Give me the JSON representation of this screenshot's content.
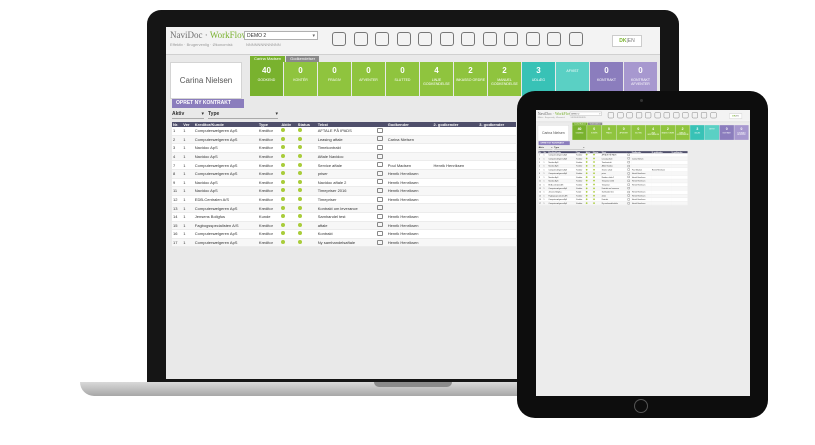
{
  "app": {
    "logo_navi": "NaviDoc",
    "logo_wf": "WorkFlow",
    "tagline": "Effektiv · Brugervenlig · Økonomisk",
    "company_select": "DEMO 2",
    "company_sub": "NNNNNNNNNNNN",
    "lang_da": "DK",
    "lang_en": "EN"
  },
  "icons": [
    "search-icon",
    "document-search-icon",
    "list-search-icon",
    "chart-icon",
    "bank-icon",
    "binders-icon",
    "refresh-icon",
    "bus-icon",
    "key-icon",
    "gear-icon",
    "chat-icon",
    "exit-icon"
  ],
  "user": {
    "name": "Carina Nielsen"
  },
  "tabs": [
    "Carina Madsen",
    "Godkendelser"
  ],
  "tiles": [
    {
      "n": "40",
      "label": "GODKEND",
      "color": "#79b22e"
    },
    {
      "n": "0",
      "label": "KONTÉR",
      "color": "#8fc43e"
    },
    {
      "n": "0",
      "label": "FRAGIV",
      "color": "#8fc43e"
    },
    {
      "n": "0",
      "label": "AFVENTER",
      "color": "#8fc43e"
    },
    {
      "n": "0",
      "label": "SLUTTED",
      "color": "#8fc43e"
    },
    {
      "n": "4",
      "label": "LINJE GODKENDELSE",
      "color": "#8fc43e"
    },
    {
      "n": "2",
      "label": "INKASSO ORDRE",
      "color": "#8fc43e"
    },
    {
      "n": "2",
      "label": "MANUEL GODKENDELSE",
      "color": "#8fc43e"
    },
    {
      "n": "3",
      "label": "UDLÆG",
      "color": "#38c2b6"
    },
    {
      "n": "",
      "label": "AFVIST",
      "color": "#5ad0c4"
    },
    {
      "n": "0",
      "label": "KONTRAKT",
      "color": "#8b7dbd"
    },
    {
      "n": "0",
      "label": "KONTRAKT AFVENTER",
      "color": "#a798cf"
    }
  ],
  "new_contract": "OPRET NY KONTRAKT",
  "filters": {
    "status": "Aktiv",
    "type": "Type"
  },
  "table": {
    "headers": [
      "Nr.",
      "Ver",
      "Kreditor/Kunde",
      "Type",
      "Aktiv",
      "Status",
      "Tekst",
      "",
      "Godkender",
      "2. godkender",
      "3. godkender"
    ],
    "rows": [
      [
        "1",
        "1",
        "Computersælgeren ApS",
        "Kreditor",
        "AFTALE PÅ IPADS",
        "",
        ""
      ],
      [
        "2",
        "1",
        "Computersælgeren ApS",
        "Kreditor",
        "Leasing aftale",
        "Carina Nielsen",
        ""
      ],
      [
        "3",
        "1",
        "Navidoc ApS",
        "Kreditor",
        "Timekontrakt",
        "",
        ""
      ],
      [
        "4",
        "1",
        "Navidoc ApS",
        "Kreditor",
        "Aftale Navidoc",
        "",
        ""
      ],
      [
        "7",
        "1",
        "Computersælgeren ApS",
        "Kreditor",
        "Service aftale",
        "Poul Madsen",
        "Henrik Henriksen"
      ],
      [
        "8",
        "1",
        "Computersælgeren ApS",
        "Kreditor",
        "priser",
        "Henrik Henriksen",
        ""
      ],
      [
        "9",
        "1",
        "Navidoc ApS",
        "Kreditor",
        "Navidoc aftale 2",
        "Henrik Henriksen",
        ""
      ],
      [
        "11",
        "1",
        "Navidoc ApS",
        "Kreditor",
        "Timepriser 2016",
        "Henrik Henriksen",
        ""
      ],
      [
        "12",
        "1",
        "EDB-Centralen A/S",
        "Kreditor",
        "Timepriser",
        "Henrik Henriksen",
        ""
      ],
      [
        "13",
        "1",
        "Computersælgeren ApS",
        "Kreditor",
        "Kontrakt om leverance",
        "",
        ""
      ],
      [
        "14",
        "1",
        "Jensens Boligfus",
        "Kunde",
        "Samhandel test",
        "Henrik Henriksen",
        ""
      ],
      [
        "15",
        "1",
        "Fagbogsspecialisten A/S",
        "Kreditor",
        "aftale",
        "Henrik Henriksen",
        ""
      ],
      [
        "16",
        "1",
        "Computersælgeren ApS",
        "Kreditor",
        "Kontrakt",
        "Henrik Henriksen",
        ""
      ],
      [
        "17",
        "1",
        "Computersælgeren ApS",
        "Kreditor",
        "Ny samhandelsaftale",
        "Henrik Henriksen",
        ""
      ]
    ]
  },
  "colors": {
    "green": "#a9cc3a",
    "purple": "#8b7dbd",
    "teal": "#38c2b6",
    "header": "#4f4f6b"
  }
}
